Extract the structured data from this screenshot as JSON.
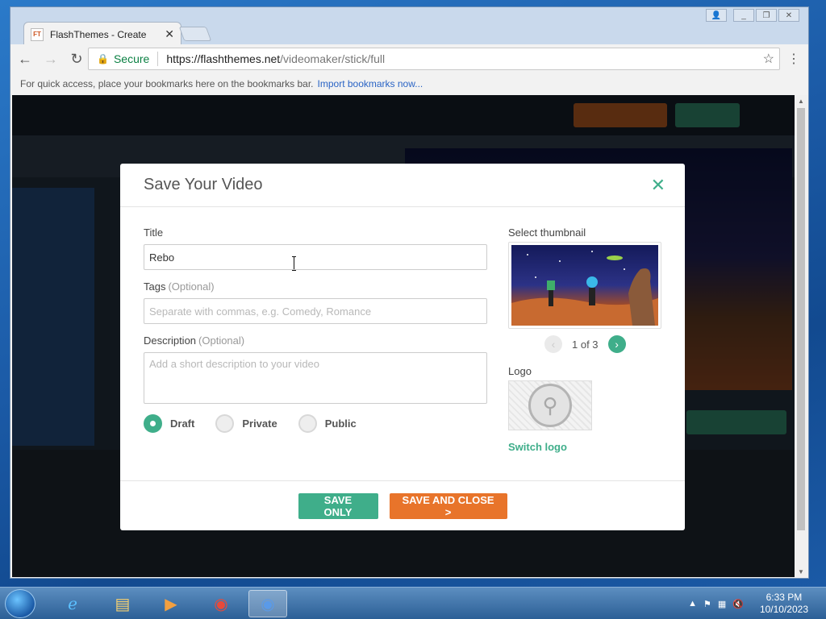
{
  "browser": {
    "tab_title": "FlashThemes - Create",
    "tab_favicon_text": "FT",
    "secure_label": "Secure",
    "url_host": "https://flashthemes.net",
    "url_path": "/videomaker/stick/full",
    "bookmarks_hint": "For quick access, place your bookmarks here on the bookmarks bar.",
    "bookmarks_import": "Import bookmarks now..."
  },
  "modal": {
    "title": "Save Your Video",
    "title_label": "Title",
    "title_value": "Rebo",
    "tags_label": "Tags",
    "tags_optional": "(Optional)",
    "tags_placeholder": "Separate with commas, e.g. Comedy, Romance",
    "description_label": "Description",
    "description_optional": "(Optional)",
    "description_placeholder": "Add a short description to your video",
    "visibility": {
      "options": [
        "Draft",
        "Private",
        "Public"
      ],
      "selected": "Draft"
    },
    "thumbnail_label": "Select thumbnail",
    "thumbnail_pager": "1 of 3",
    "logo_label": "Logo",
    "switch_logo": "Switch logo",
    "save_only": "SAVE ONLY",
    "save_and_close": "SAVE AND CLOSE >"
  },
  "taskbar": {
    "time": "6:33 PM",
    "date": "10/10/2023"
  },
  "colors": {
    "accent_green": "#3fae8a",
    "accent_orange": "#e8742a"
  }
}
